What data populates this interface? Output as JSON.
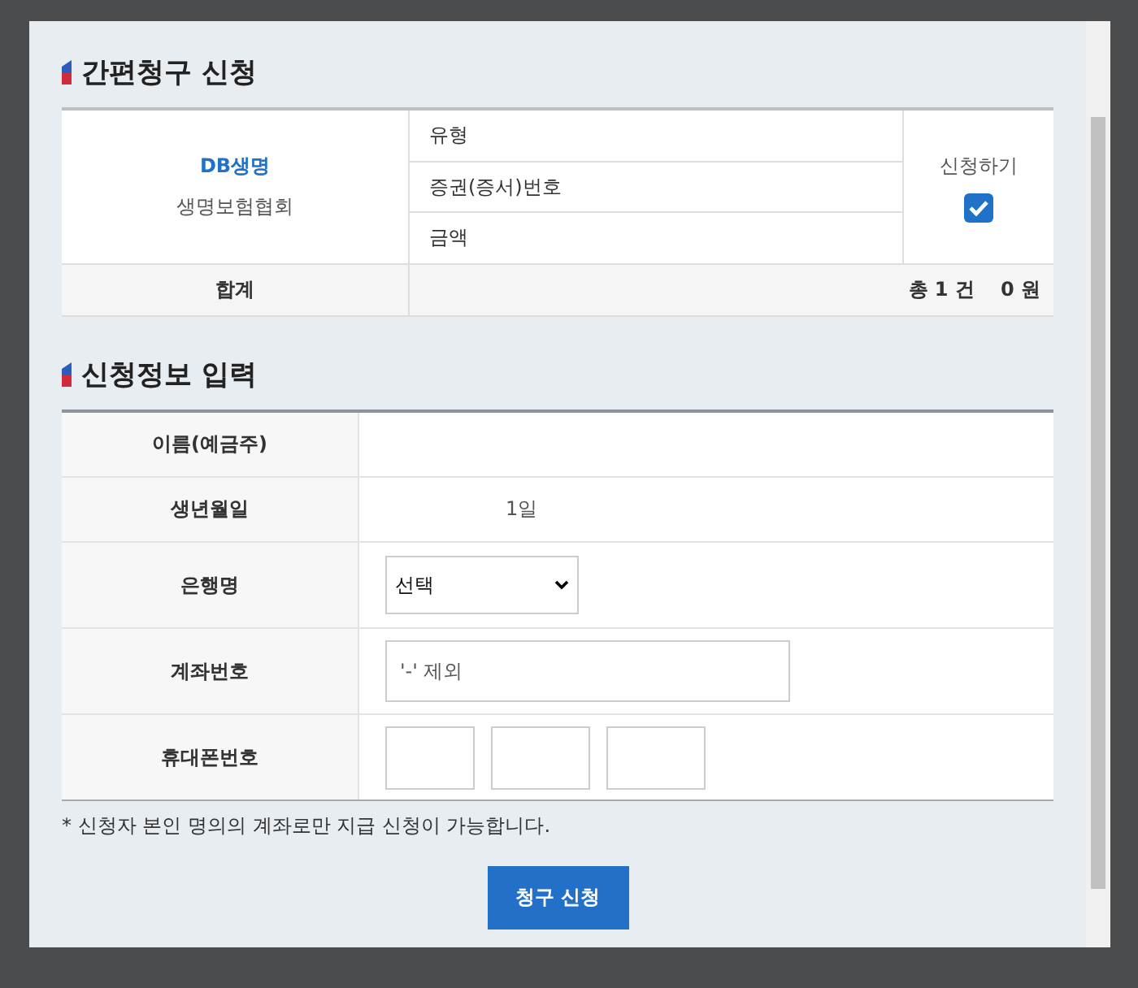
{
  "claim_section": {
    "title": "간편청구 신청",
    "company": {
      "name": "DB생명",
      "association": "생명보험협회"
    },
    "fields": [
      "유형",
      "증권(증서)번호",
      "금액"
    ],
    "apply": {
      "label": "신청하기",
      "checked": true
    },
    "total": {
      "label": "합계",
      "count": "총 1 건",
      "amount": "0 원"
    }
  },
  "info_section": {
    "title": "신청정보 입력",
    "rows": [
      {
        "kind": "text",
        "label": "이름(예금주)",
        "value": ""
      },
      {
        "kind": "text",
        "label": "생년월일",
        "value": "1일"
      },
      {
        "kind": "select",
        "label": "은행명",
        "value": "선택"
      },
      {
        "kind": "input",
        "label": "계좌번호",
        "placeholder": "'-' 제외"
      },
      {
        "kind": "phone",
        "label": "휴대폰번호"
      }
    ]
  },
  "note": "* 신청자 본인 명의의 계좌로만 지급 신청이 가능합니다.",
  "submit": "청구 신청"
}
